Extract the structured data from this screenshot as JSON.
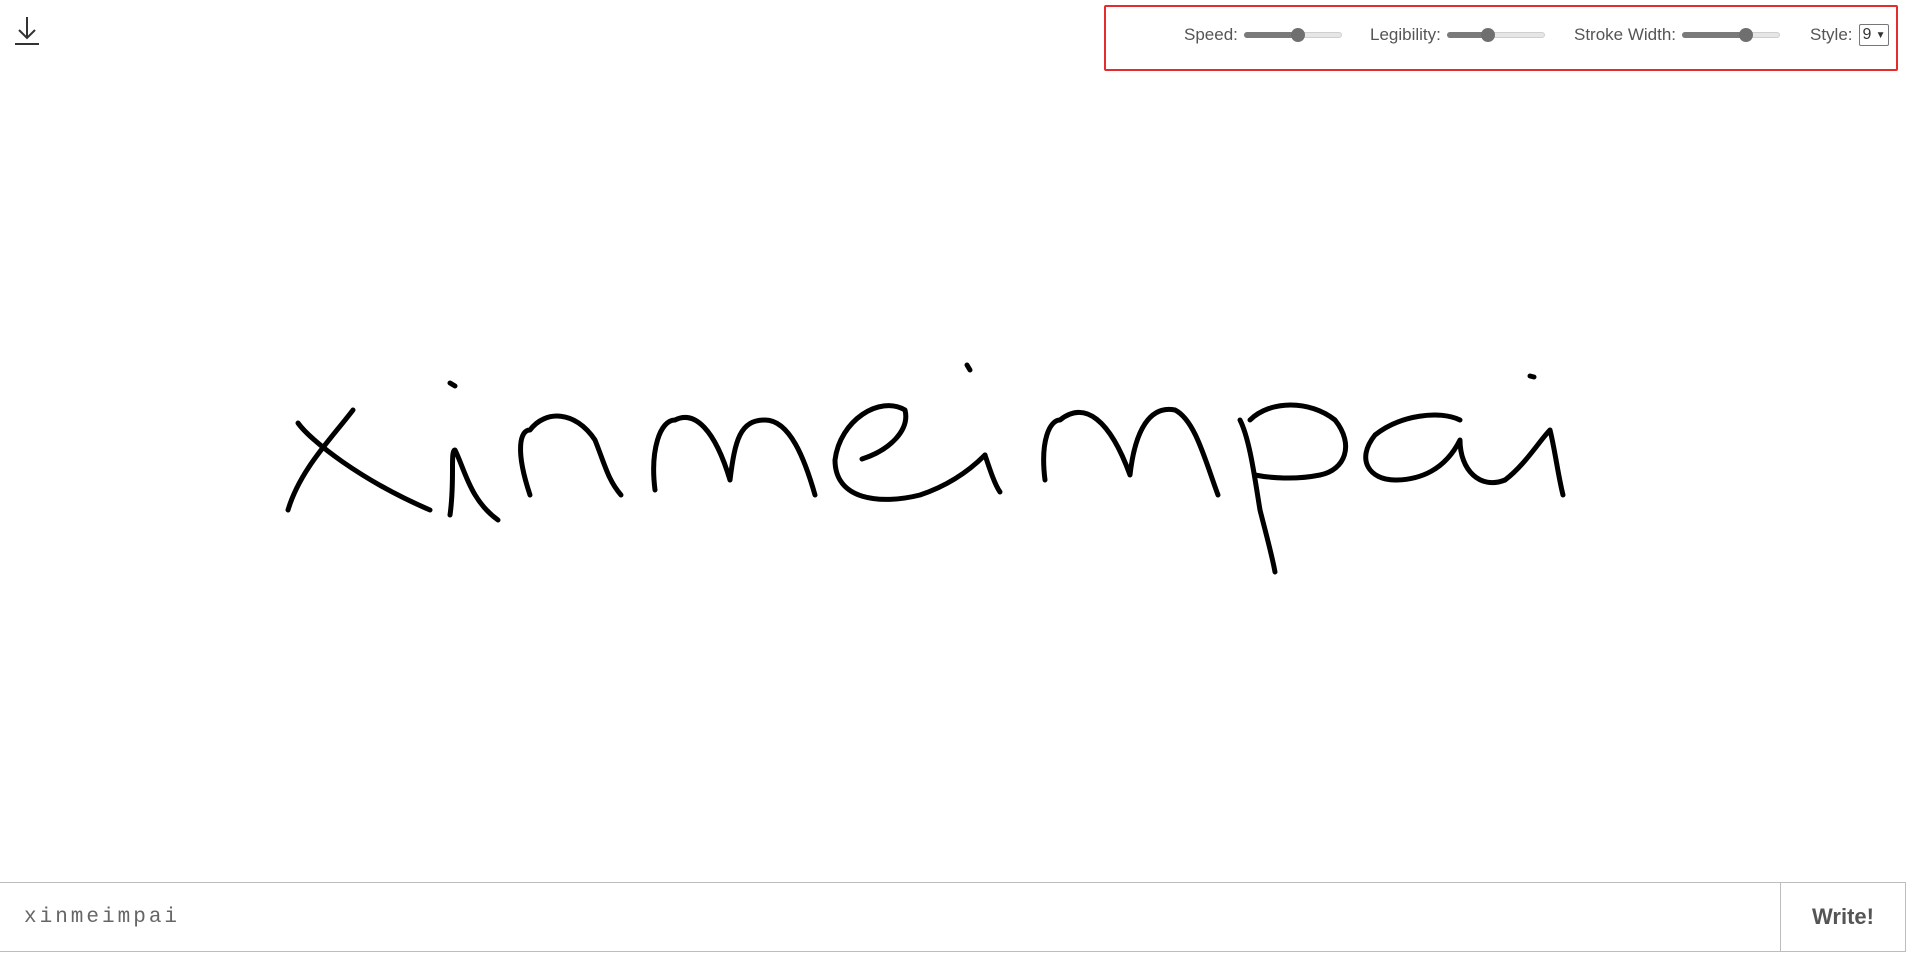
{
  "toolbar": {
    "download_icon": "download-arrow-icon"
  },
  "controls": {
    "speed": {
      "label": "Speed:",
      "value": 0.55
    },
    "legibility": {
      "label": "Legibility:",
      "value": 0.42
    },
    "stroke_width": {
      "label": "Stroke Width:",
      "value": 0.65
    },
    "style": {
      "label": "Style:",
      "selected": "9"
    }
  },
  "colors": {
    "highlight_border": "#e52b2b",
    "ink": "#000000"
  },
  "input": {
    "value": "xinmeimpai"
  },
  "write_button": {
    "label": "Write!"
  }
}
